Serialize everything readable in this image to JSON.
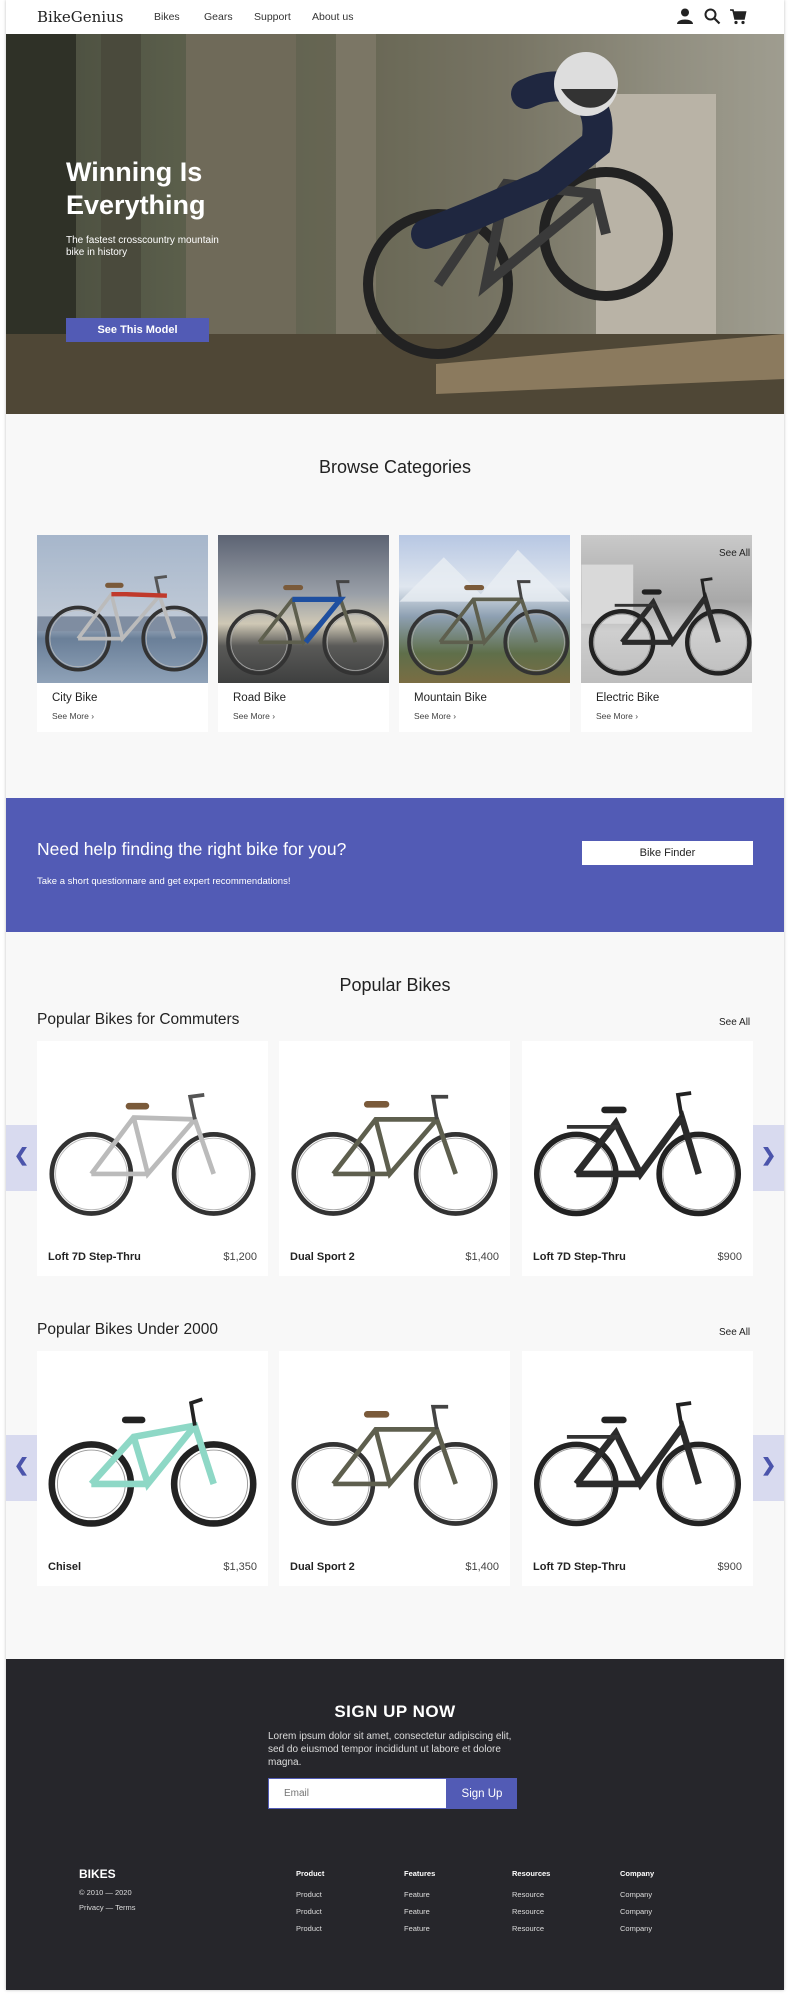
{
  "nav": {
    "logo": "BikeGenius",
    "links": [
      "Bikes",
      "Gears",
      "Support",
      "About us"
    ]
  },
  "hero": {
    "title": "Winning Is Everything",
    "subtitle": "The fastest crosscountry mountain bike in history",
    "button": "See This Model"
  },
  "categories": {
    "title": "Browse Categories",
    "see_all": "See All",
    "items": [
      {
        "name": "City Bike",
        "more": "See More ›"
      },
      {
        "name": "Road Bike",
        "more": "See More ›"
      },
      {
        "name": "Mountain Bike",
        "more": "See More ›"
      },
      {
        "name": "Electric Bike",
        "more": "See More ›"
      }
    ]
  },
  "finder": {
    "title": "Need help finding the right bike for you?",
    "subtitle": "Take a short questionnare and get expert recommendations!",
    "button": "Bike Finder"
  },
  "popular": {
    "title": "Popular Bikes",
    "rows": [
      {
        "title": "Popular Bikes for Commuters",
        "see_all": "See All",
        "items": [
          {
            "name": "Loft 7D Step-Thru",
            "price": "$1,200"
          },
          {
            "name": "Dual Sport 2",
            "price": "$1,400"
          },
          {
            "name": "Loft 7D Step-Thru",
            "price": "$900"
          }
        ]
      },
      {
        "title": "Popular Bikes Under 2000",
        "see_all": "See All",
        "items": [
          {
            "name": "Chisel",
            "price": "$1,350"
          },
          {
            "name": "Dual Sport 2",
            "price": "$1,400"
          },
          {
            "name": "Loft 7D Step-Thru",
            "price": "$900"
          }
        ]
      }
    ]
  },
  "signup": {
    "title": "SIGN UP NOW",
    "text": "Lorem ipsum dolor sit amet, consectetur adipiscing elit, sed do eiusmod tempor incididunt ut labore et dolore magna.",
    "placeholder": "Email",
    "button": "Sign Up"
  },
  "footer": {
    "brand": "BIKES",
    "copyright": "© 2010 — 2020",
    "legal": "Privacy — Terms",
    "columns": [
      {
        "heading": "Product",
        "items": [
          "Product",
          "Product",
          "Product"
        ]
      },
      {
        "heading": "Features",
        "items": [
          "Feature",
          "Feature",
          "Feature"
        ]
      },
      {
        "heading": "Resources",
        "items": [
          "Resource",
          "Resource",
          "Resource"
        ]
      },
      {
        "heading": "Company",
        "items": [
          "Company",
          "Company",
          "Company"
        ]
      }
    ]
  },
  "colors": {
    "accent": "#525bb5",
    "footer_bg": "#26262b",
    "page_bg": "#f8f8f8"
  },
  "icons": [
    "user-icon",
    "search-icon",
    "cart-icon",
    "chevron-left-icon",
    "chevron-right-icon"
  ]
}
